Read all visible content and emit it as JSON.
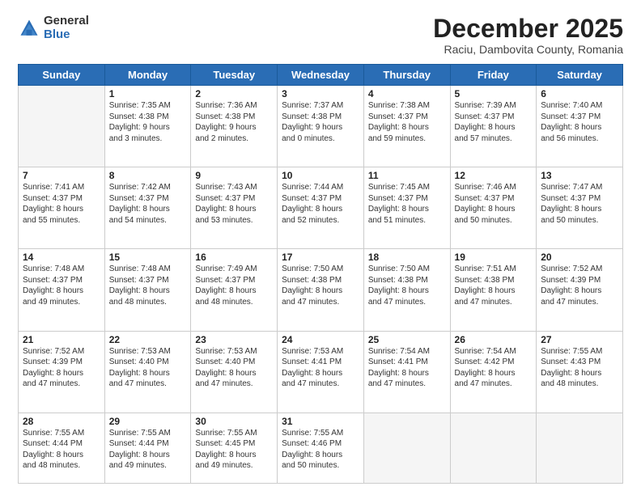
{
  "logo": {
    "general": "General",
    "blue": "Blue"
  },
  "title": "December 2025",
  "subtitle": "Raciu, Dambovita County, Romania",
  "days_header": [
    "Sunday",
    "Monday",
    "Tuesday",
    "Wednesday",
    "Thursday",
    "Friday",
    "Saturday"
  ],
  "weeks": [
    [
      {
        "num": "",
        "info": ""
      },
      {
        "num": "1",
        "info": "Sunrise: 7:35 AM\nSunset: 4:38 PM\nDaylight: 9 hours\nand 3 minutes."
      },
      {
        "num": "2",
        "info": "Sunrise: 7:36 AM\nSunset: 4:38 PM\nDaylight: 9 hours\nand 2 minutes."
      },
      {
        "num": "3",
        "info": "Sunrise: 7:37 AM\nSunset: 4:38 PM\nDaylight: 9 hours\nand 0 minutes."
      },
      {
        "num": "4",
        "info": "Sunrise: 7:38 AM\nSunset: 4:37 PM\nDaylight: 8 hours\nand 59 minutes."
      },
      {
        "num": "5",
        "info": "Sunrise: 7:39 AM\nSunset: 4:37 PM\nDaylight: 8 hours\nand 57 minutes."
      },
      {
        "num": "6",
        "info": "Sunrise: 7:40 AM\nSunset: 4:37 PM\nDaylight: 8 hours\nand 56 minutes."
      }
    ],
    [
      {
        "num": "7",
        "info": "Sunrise: 7:41 AM\nSunset: 4:37 PM\nDaylight: 8 hours\nand 55 minutes."
      },
      {
        "num": "8",
        "info": "Sunrise: 7:42 AM\nSunset: 4:37 PM\nDaylight: 8 hours\nand 54 minutes."
      },
      {
        "num": "9",
        "info": "Sunrise: 7:43 AM\nSunset: 4:37 PM\nDaylight: 8 hours\nand 53 minutes."
      },
      {
        "num": "10",
        "info": "Sunrise: 7:44 AM\nSunset: 4:37 PM\nDaylight: 8 hours\nand 52 minutes."
      },
      {
        "num": "11",
        "info": "Sunrise: 7:45 AM\nSunset: 4:37 PM\nDaylight: 8 hours\nand 51 minutes."
      },
      {
        "num": "12",
        "info": "Sunrise: 7:46 AM\nSunset: 4:37 PM\nDaylight: 8 hours\nand 50 minutes."
      },
      {
        "num": "13",
        "info": "Sunrise: 7:47 AM\nSunset: 4:37 PM\nDaylight: 8 hours\nand 50 minutes."
      }
    ],
    [
      {
        "num": "14",
        "info": "Sunrise: 7:48 AM\nSunset: 4:37 PM\nDaylight: 8 hours\nand 49 minutes."
      },
      {
        "num": "15",
        "info": "Sunrise: 7:48 AM\nSunset: 4:37 PM\nDaylight: 8 hours\nand 48 minutes."
      },
      {
        "num": "16",
        "info": "Sunrise: 7:49 AM\nSunset: 4:37 PM\nDaylight: 8 hours\nand 48 minutes."
      },
      {
        "num": "17",
        "info": "Sunrise: 7:50 AM\nSunset: 4:38 PM\nDaylight: 8 hours\nand 47 minutes."
      },
      {
        "num": "18",
        "info": "Sunrise: 7:50 AM\nSunset: 4:38 PM\nDaylight: 8 hours\nand 47 minutes."
      },
      {
        "num": "19",
        "info": "Sunrise: 7:51 AM\nSunset: 4:38 PM\nDaylight: 8 hours\nand 47 minutes."
      },
      {
        "num": "20",
        "info": "Sunrise: 7:52 AM\nSunset: 4:39 PM\nDaylight: 8 hours\nand 47 minutes."
      }
    ],
    [
      {
        "num": "21",
        "info": "Sunrise: 7:52 AM\nSunset: 4:39 PM\nDaylight: 8 hours\nand 47 minutes."
      },
      {
        "num": "22",
        "info": "Sunrise: 7:53 AM\nSunset: 4:40 PM\nDaylight: 8 hours\nand 47 minutes."
      },
      {
        "num": "23",
        "info": "Sunrise: 7:53 AM\nSunset: 4:40 PM\nDaylight: 8 hours\nand 47 minutes."
      },
      {
        "num": "24",
        "info": "Sunrise: 7:53 AM\nSunset: 4:41 PM\nDaylight: 8 hours\nand 47 minutes."
      },
      {
        "num": "25",
        "info": "Sunrise: 7:54 AM\nSunset: 4:41 PM\nDaylight: 8 hours\nand 47 minutes."
      },
      {
        "num": "26",
        "info": "Sunrise: 7:54 AM\nSunset: 4:42 PM\nDaylight: 8 hours\nand 47 minutes."
      },
      {
        "num": "27",
        "info": "Sunrise: 7:55 AM\nSunset: 4:43 PM\nDaylight: 8 hours\nand 48 minutes."
      }
    ],
    [
      {
        "num": "28",
        "info": "Sunrise: 7:55 AM\nSunset: 4:44 PM\nDaylight: 8 hours\nand 48 minutes."
      },
      {
        "num": "29",
        "info": "Sunrise: 7:55 AM\nSunset: 4:44 PM\nDaylight: 8 hours\nand 49 minutes."
      },
      {
        "num": "30",
        "info": "Sunrise: 7:55 AM\nSunset: 4:45 PM\nDaylight: 8 hours\nand 49 minutes."
      },
      {
        "num": "31",
        "info": "Sunrise: 7:55 AM\nSunset: 4:46 PM\nDaylight: 8 hours\nand 50 minutes."
      },
      {
        "num": "",
        "info": ""
      },
      {
        "num": "",
        "info": ""
      },
      {
        "num": "",
        "info": ""
      }
    ]
  ]
}
